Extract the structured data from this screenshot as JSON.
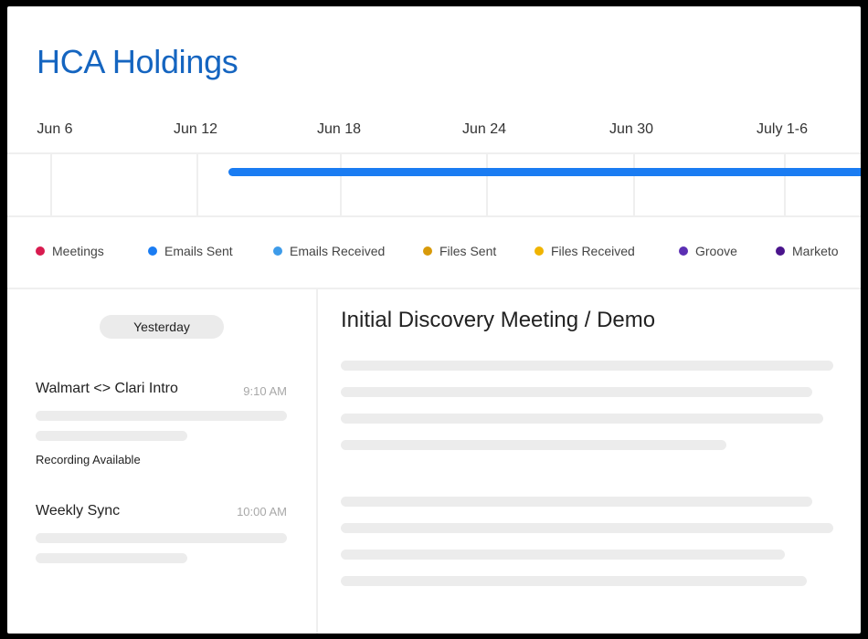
{
  "header": {
    "title": "HCA Holdings"
  },
  "timeline": {
    "dates": [
      "Jun 6",
      "Jun 12",
      "Jun 18",
      "Jun 24",
      "Jun 30",
      "July 1-6"
    ]
  },
  "legend": [
    {
      "label": "Meetings",
      "color": "#d81b4f"
    },
    {
      "label": "Emails Sent",
      "color": "#1a7cf2"
    },
    {
      "label": "Emails Received",
      "color": "#3d9be9"
    },
    {
      "label": "Files Sent",
      "color": "#d89a0a"
    },
    {
      "label": "Files Received",
      "color": "#f0b400"
    },
    {
      "label": "Groove",
      "color": "#5b2fb3"
    },
    {
      "label": "Marketo",
      "color": "#4a148c"
    }
  ],
  "activity": {
    "day_label": "Yesterday",
    "items": [
      {
        "title": "Walmart <> Clari Intro",
        "time": "9:10 AM",
        "note": "Recording Available"
      },
      {
        "title": "Weekly Sync",
        "time": "10:00 AM"
      }
    ]
  },
  "detail": {
    "title": "Initial Discovery Meeting / Demo"
  },
  "colors": {
    "accent": "#1565c0",
    "bar": "#1a7cf2"
  }
}
